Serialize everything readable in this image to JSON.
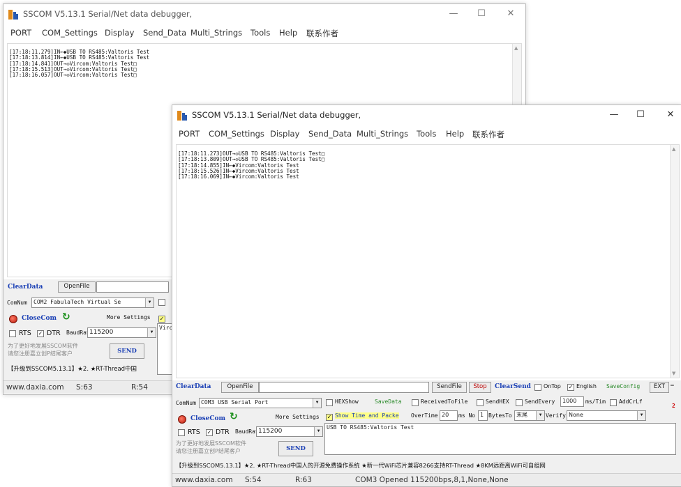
{
  "window_back": {
    "title": "SSCOM V5.13.1 Serial/Net data debugger,",
    "menu": [
      "PORT",
      "COM_Settings",
      "Display",
      "Send_Data",
      "Multi_Strings",
      "Tools",
      "Help",
      "联系作者"
    ],
    "log_lines": [
      "[17:18:11.279]IN←◆USB TO RS485:Valtoris Test",
      "[17:18:13.814]IN←◆USB TO RS485:Valtoris Test",
      "[17:18:14.841]OUT→◇Vircom:Valtoris Test□",
      "[17:18:15.513]OUT→◇Vircom:Valtoris Test□",
      "[17:18:16.057]OUT→◇Vircom:Valtoris Test□"
    ],
    "clear_data": "ClearData",
    "open_file": "OpenFile",
    "com_label": "ComNum",
    "com_value": "COM2 FabulaTech Virtual Se",
    "close_com": "CloseCom",
    "more_settings": "More Settings",
    "rts": "RTS",
    "dtr": "DTR",
    "baud_label": "BaudRat",
    "baud_value": "115200",
    "promo_1": "为了更好地发展SSCOM软件",
    "promo_2": "请您注册嘉立创P结尾客户",
    "send": "SEND",
    "ticker": "【升级到SSCOM5.13.1】★2. ★RT-Thread中国",
    "send_preview": "Virc",
    "status": {
      "site": "www.daxia.com",
      "s": "S:63",
      "r": "R:54"
    }
  },
  "window_front": {
    "title": "SSCOM V5.13.1 Serial/Net data debugger,",
    "menu": [
      "PORT",
      "COM_Settings",
      "Display",
      "Send_Data",
      "Multi_Strings",
      "Tools",
      "Help",
      "联系作者"
    ],
    "log_lines": [
      "[17:18:11.273]OUT→◇USB TO RS485:Valtoris Test□",
      "[17:18:13.809]OUT→◇USB TO RS485:Valtoris Test□",
      "[17:18:14.855]IN←◆Vircom:Valtoris Test",
      "[17:18:15.526]IN←◆Vircom:Valtoris Test",
      "[17:18:16.069]IN←◆Vircom:Valtoris Test"
    ],
    "clear_data": "ClearData",
    "open_file": "OpenFile",
    "send_file": "SendFile",
    "stop": "Stop",
    "clear_send": "ClearSend",
    "on_top": "OnTop",
    "english": "English",
    "save_config": "SaveConfig",
    "ext": "EXT",
    "com_label": "ComNum",
    "com_value": "COM3 USB Serial Port",
    "hex_show": "HEXShow",
    "save_data": "SaveData",
    "received_to_file": "ReceivedToFile",
    "send_hex": "SendHEX",
    "send_every": "SendEvery",
    "interval": "1000",
    "interval_unit": "ms/Tim",
    "add_crlf": "AddCrLf",
    "close_com": "CloseCom",
    "more_settings": "More Settings",
    "show_time": "Show Time and Packe",
    "overtime_label": "OverTime",
    "overtime_value": "20",
    "ms_no": "ms No",
    "bytes_value": "1",
    "bytes_to": "BytesTo",
    "tail_value": "末尾",
    "verify_label": "Verify",
    "verify_value": "None",
    "rts": "RTS",
    "dtr": "DTR",
    "baud_label": "BaudRat",
    "baud_value": "115200",
    "send_text": "USB TO RS485:Valtoris Test",
    "promo_1": "为了更好地发展SSCOM软件",
    "promo_2": "请您注册嘉立创P结尾客户",
    "send": "SEND",
    "ticker": "【升级到SSCOM5.13.1】★2. ★RT-Thread中国人的开源免费操作系统 ★新一代WiFi芯片兼容8266支持RT-Thread ★8KM远距离WiFi可自组网",
    "status": {
      "site": "www.daxia.com",
      "s": "S:54",
      "r": "R:63",
      "port": "COM3 Opened 115200bps,8,1,None,None"
    }
  },
  "colors": {
    "accent_blue": "#1a3fb5",
    "highlight_yellow": "#ffff88",
    "close_red": "#c8200f",
    "refresh_green": "#1a8f1a"
  }
}
